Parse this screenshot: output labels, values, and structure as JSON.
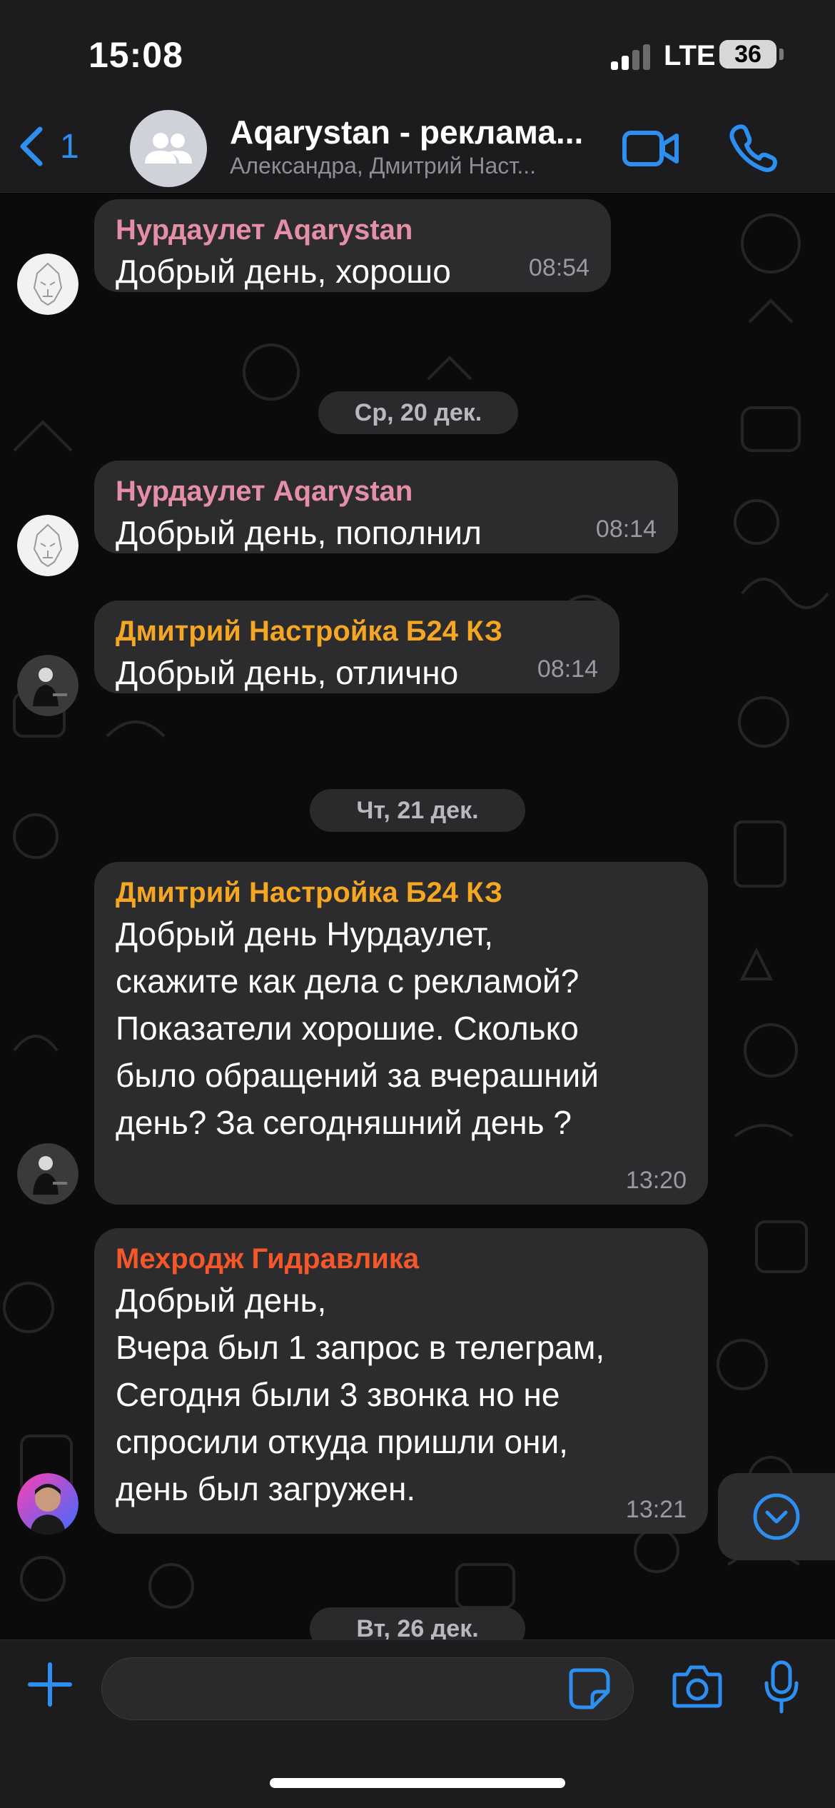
{
  "status_bar": {
    "time": "15:08",
    "network": "LTE",
    "battery": "36"
  },
  "header": {
    "back_count": "1",
    "title": "Aqarystan - реклама...",
    "subtitle": "Александра, Дмитрий Наст..."
  },
  "messages": [
    {
      "sender": "Нурдаулет Aqarystan",
      "text": "Добрый день, хорошо",
      "time": "08:54"
    },
    {
      "sender": "Нурдаулет Aqarystan",
      "text": "Добрый день, пополнил",
      "time": "08:14"
    },
    {
      "sender": "Дмитрий Настройка Б24 КЗ",
      "text": "Добрый день, отлично",
      "time": "08:14"
    },
    {
      "sender": "Дмитрий Настройка Б24 КЗ",
      "text": "Добрый день Нурдаулет,\nскажите как дела с рекламой?\nПоказатели хорошие. Сколько\nбыло обращений за вчерашний\nдень? За сегодняшний день ?",
      "time": "13:20"
    },
    {
      "sender": "Мехродж Гидравлика",
      "text": "Добрый день,\nВчера был 1 запрос в телеграм,\nСегодня были 3 звонка но не\nспросили откуда пришли они,\nдень был загружен.",
      "time": "13:21"
    }
  ],
  "dates": [
    "Ср, 20 дек.",
    "Чт, 21 дек.",
    "Вт, 26 дек."
  ],
  "composer": {
    "placeholder": ""
  },
  "colors": {
    "accent": "#2d8ff0",
    "sender_nurdaulet": "#e58fa6",
    "sender_dmitry": "#f5a623",
    "sender_mehrodzh": "#f5572a",
    "bubble": "#2c2c2e"
  },
  "icons": [
    "back-chevron-icon",
    "group-icon",
    "video-call-icon",
    "phone-icon",
    "plus-icon",
    "sticker-icon",
    "camera-icon",
    "microphone-icon",
    "scroll-down-icon"
  ]
}
